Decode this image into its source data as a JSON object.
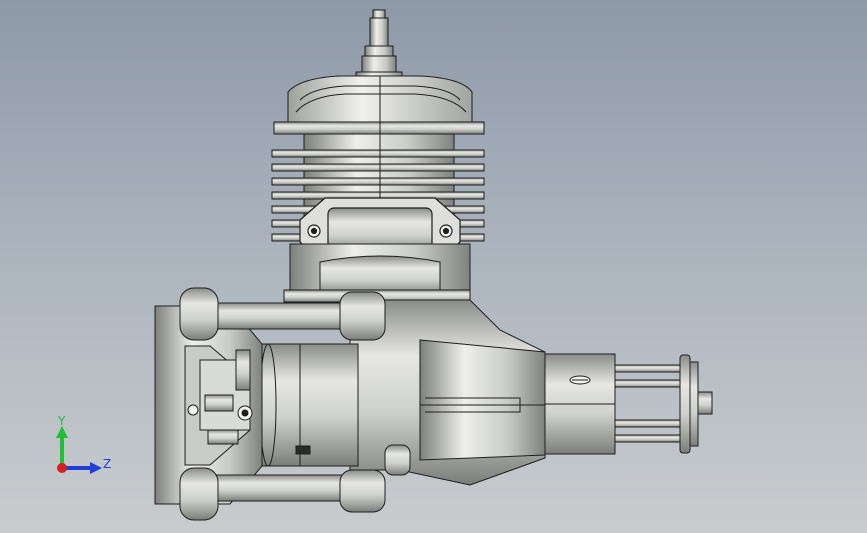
{
  "viewport": {
    "background_top": "#8e99a8",
    "background_bottom": "#c9ccce"
  },
  "model": {
    "part_color": "#d7d9d4",
    "edge_color": "#1e1e1e",
    "shade_color": "#9a9c98"
  },
  "triad": {
    "y_label": "Y",
    "z_label": "Z",
    "y_color": "#1fbf3a",
    "z_color": "#1f3fd6",
    "x_color": "#d42020"
  }
}
